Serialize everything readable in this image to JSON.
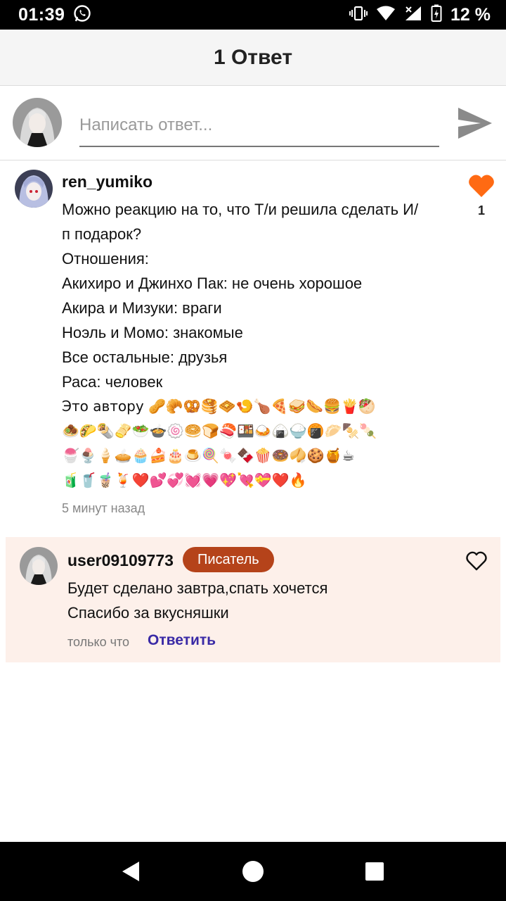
{
  "status_bar": {
    "time": "01:39",
    "battery_percent": "12 %",
    "icons": [
      "whatsapp-icon",
      "vibrate-icon",
      "wifi-icon",
      "signal-icon",
      "battery-charging-icon"
    ]
  },
  "header": {
    "title": "1 Ответ"
  },
  "composer": {
    "placeholder": "Написать ответ...",
    "send_icon": "send-icon"
  },
  "comment": {
    "username": "ren_yumiko",
    "like_count": "1",
    "liked": true,
    "lines": [
      "Можно реакцию на то, что Т/и решила сделать И/",
      "п подарок?",
      "Отношения:",
      "Акихиро и Джинхо Пак: не очень хорошое",
      "Акира и Мизуки: враги",
      "Ноэль и Момо: знакомые",
      "Все остальные: друзья",
      "Раса: человек"
    ],
    "emoji_lines": [
      "Это автору 🥜🥐🥨🥞🧇🍤🍗🍕🥪🌭🍔🍟🥙",
      "🧆🌮🌯🫔🥗🍲🍥🥯🍞🍣🍱🍛🍙🍚🍘🥟🍢🍡",
      "🍧🍨🍦🥧🧁🍰🎂🍮🍭🍬🍫🍿🍩🥠🍪🍯☕",
      "🧃🥤🧋🍹❤️💕💞💓💗💖💘💝❤️🔥"
    ],
    "time": "5 минут назад"
  },
  "reply": {
    "username": "user09109773",
    "badge": "Писатель",
    "lines": [
      "Будет сделано завтра,спать хочется",
      "Спасибо за вкусняшки"
    ],
    "time": "только что",
    "reply_label": "Ответить"
  },
  "colors": {
    "like_active": "#ff6a13",
    "badge_bg": "#b5431a",
    "reply_bg": "#fdf0ea",
    "reply_link": "#3a2aa6"
  },
  "nav_bar": {
    "icons": [
      "back-icon",
      "home-icon",
      "recents-icon"
    ]
  }
}
